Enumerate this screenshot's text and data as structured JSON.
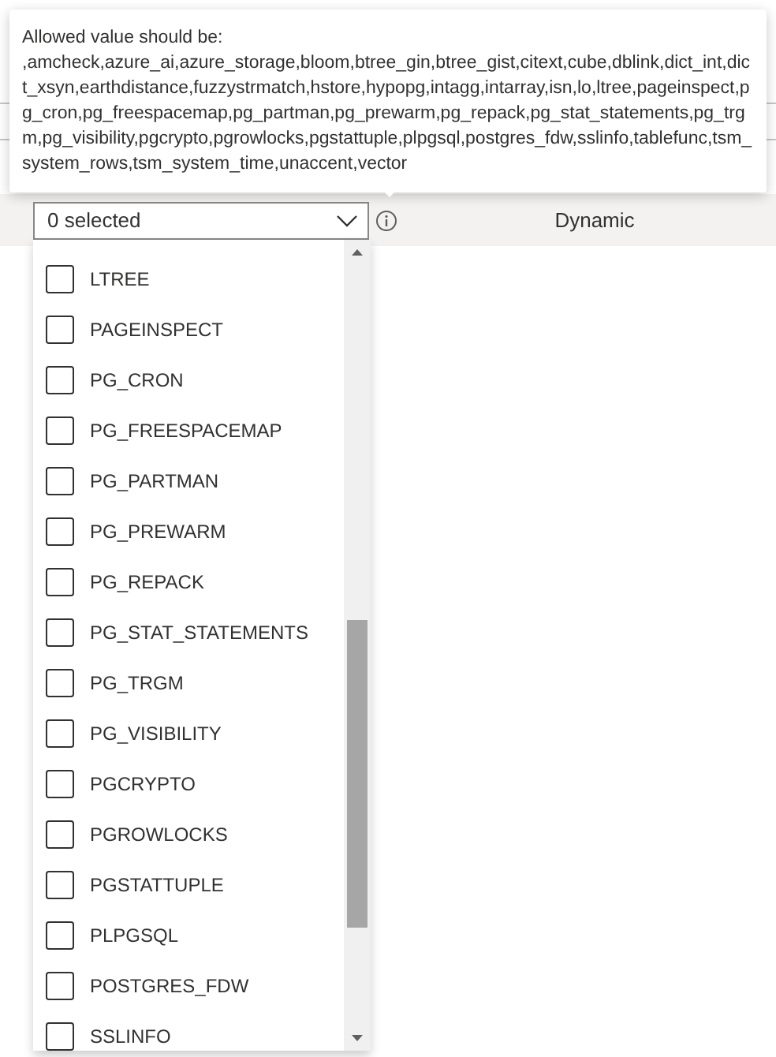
{
  "tooltip": {
    "title": "Allowed value should be:",
    "text": ",amcheck,azure_ai,azure_storage,bloom,btree_gin,btree_gist,citext,cube,dblink,dict_int,dict_xsyn,earthdistance,fuzzystrmatch,hstore,hypopg,intagg,intarray,isn,lo,ltree,pageinspect,pg_cron,pg_freespacemap,pg_partman,pg_prewarm,pg_repack,pg_stat_statements,pg_trgm,pg_visibility,pgcrypto,pgrowlocks,pgstattuple,plpgsql,postgres_fdw,sslinfo,tablefunc,tsm_system_rows,tsm_system_time,unaccent,vector"
  },
  "row": {
    "select_value": "0 selected",
    "type": "Dynamic"
  },
  "options": [
    {
      "label": "LTREE",
      "checked": false
    },
    {
      "label": "PAGEINSPECT",
      "checked": false
    },
    {
      "label": "PG_CRON",
      "checked": false
    },
    {
      "label": "PG_FREESPACEMAP",
      "checked": false
    },
    {
      "label": "PG_PARTMAN",
      "checked": false
    },
    {
      "label": "PG_PREWARM",
      "checked": false
    },
    {
      "label": "PG_REPACK",
      "checked": false
    },
    {
      "label": "PG_STAT_STATEMENTS",
      "checked": false
    },
    {
      "label": "PG_TRGM",
      "checked": false
    },
    {
      "label": "PG_VISIBILITY",
      "checked": false
    },
    {
      "label": "PGCRYPTO",
      "checked": false
    },
    {
      "label": "PGROWLOCKS",
      "checked": false
    },
    {
      "label": "PGSTATTUPLE",
      "checked": false
    },
    {
      "label": "PLPGSQL",
      "checked": false
    },
    {
      "label": "POSTGRES_FDW",
      "checked": false
    },
    {
      "label": "SSLINFO",
      "checked": false
    }
  ]
}
